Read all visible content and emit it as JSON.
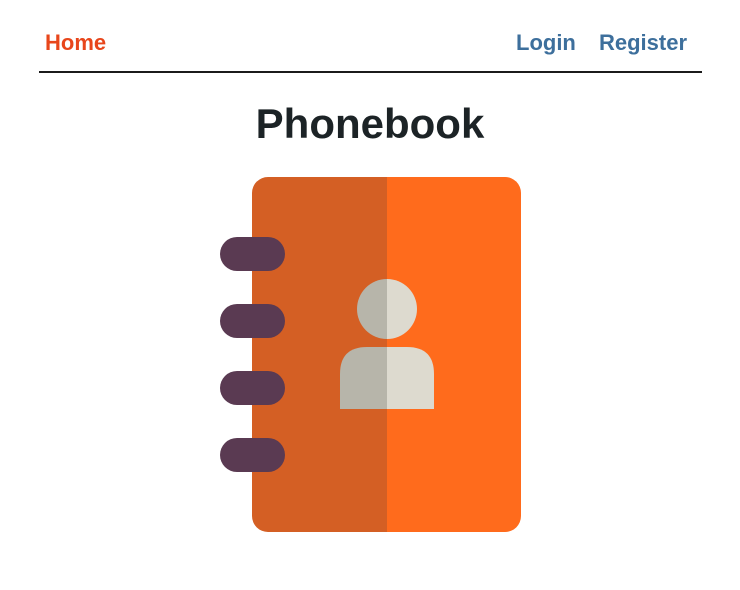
{
  "nav": {
    "home_label": "Home",
    "login_label": "Login",
    "register_label": "Register"
  },
  "main": {
    "title": "Phonebook",
    "illustration": "phonebook-icon"
  },
  "colors": {
    "home_link": "#e8461b",
    "auth_link": "#3d6f9c",
    "title": "#1c2326",
    "book_spine": "#d45f24",
    "book_cover": "#ff6b1c",
    "ring": "#5a3a52",
    "person_left": "#b7b5aa",
    "person_right": "#dddacf"
  }
}
